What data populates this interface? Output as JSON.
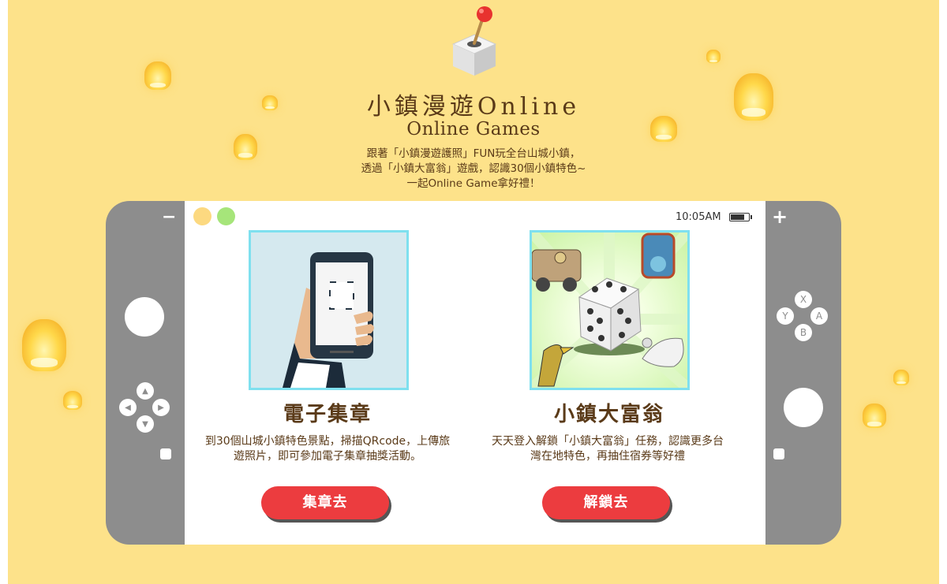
{
  "header": {
    "title": "小鎮漫遊Online",
    "subtitle": "Online Games",
    "desc_lines": [
      "跟著「小鎮漫遊護照」FUN玩全台山城小鎮，",
      "透過「小鎮大富翁」遊戲，認識30個小鎮特色~",
      "一起Online Game拿好禮！"
    ]
  },
  "device": {
    "minus": "−",
    "plus": "+",
    "time": "10:05AM",
    "buttons": {
      "x": "X",
      "y": "Y",
      "a": "A",
      "b": "B"
    },
    "dpad": {
      "up": "▲",
      "down": "▼",
      "left": "◀",
      "right": "▶"
    },
    "dot_colors": [
      "#fcd980",
      "#a6e57a"
    ]
  },
  "cards": [
    {
      "title": "電子集章",
      "desc_lines": [
        "到30個山城小鎮特色景點，掃描QRcode，上傳旅",
        "遊照片，即可參加電子集章抽獎活動。"
      ],
      "button": "集章去"
    },
    {
      "title": "小鎮大富翁",
      "desc_lines": [
        "天天登入解鎖「小鎮大富翁」任務，認識更多台",
        "灣在地特色，再抽住宿券等好禮"
      ],
      "button": "解鎖去"
    }
  ],
  "colors": {
    "background": "#fde28a",
    "console": "#8d8d8d",
    "accent_button": "#ec3c3f",
    "frame": "#7fe0ef",
    "text": "#5a3a18"
  }
}
